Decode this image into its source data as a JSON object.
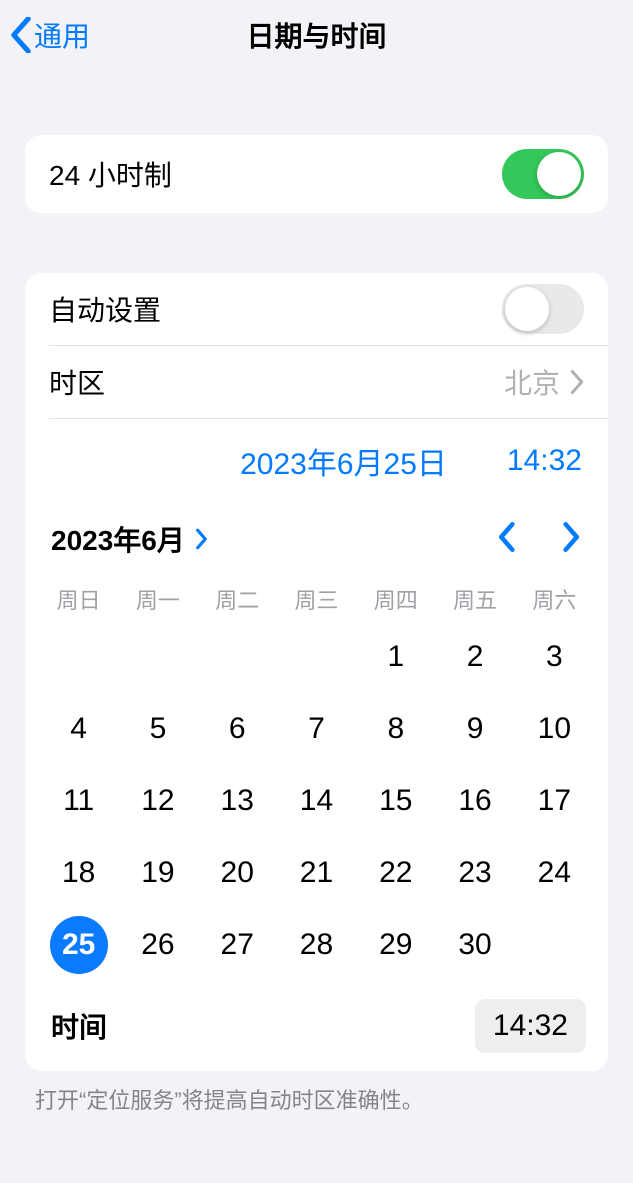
{
  "header": {
    "back_label": "通用",
    "title": "日期与时间"
  },
  "settings": {
    "twenty_four_hour_label": "24 小时制",
    "auto_set_label": "自动设置",
    "timezone_label": "时区",
    "timezone_value": "北京"
  },
  "summary": {
    "date": "2023年6月25日",
    "time": "14:32"
  },
  "calendar": {
    "month_label": "2023年6月",
    "weekdays": [
      "周日",
      "周一",
      "周二",
      "周三",
      "周四",
      "周五",
      "周六"
    ],
    "time_label": "时间",
    "time_value": "14:32",
    "first_weekday": 4,
    "days_in_month": 30,
    "selected_day": 25
  },
  "footer_note": "打开“定位服务”将提高自动时区准确性。"
}
